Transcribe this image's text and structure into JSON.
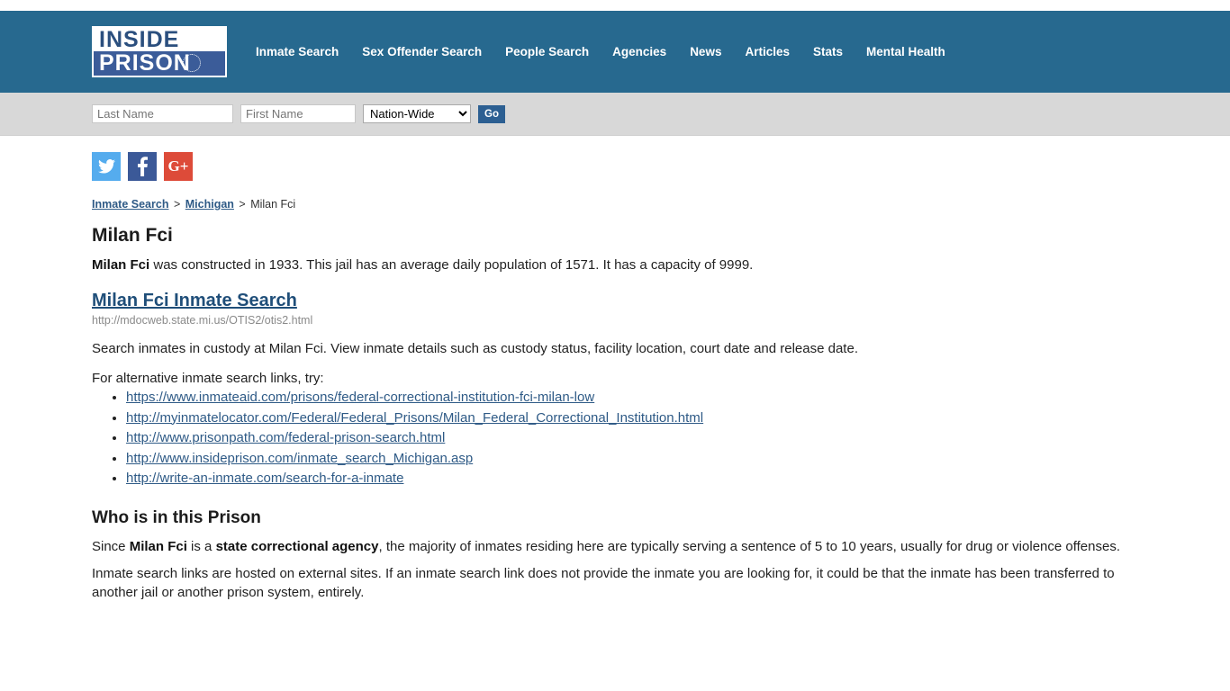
{
  "header": {
    "logo": {
      "line1": "INSIDE",
      "line2": "PRISON",
      "icon": "prison-ring-icon"
    },
    "nav": [
      {
        "label": "Inmate Search"
      },
      {
        "label": "Sex Offender Search"
      },
      {
        "label": "People Search"
      },
      {
        "label": "Agencies"
      },
      {
        "label": "News"
      },
      {
        "label": "Articles"
      },
      {
        "label": "Stats"
      },
      {
        "label": "Mental Health"
      }
    ],
    "brand_color": "#27698f"
  },
  "search_bar": {
    "last_name_placeholder": "Last Name",
    "last_name_value": "",
    "first_name_placeholder": "First Name",
    "first_name_value": "",
    "scope_selected": "Nation-Wide",
    "scope_options": [
      "Nation-Wide"
    ],
    "go_label": "Go",
    "go_color": "#2c5f92"
  },
  "social": [
    {
      "name": "twitter",
      "glyph": "🐦",
      "color": "#55acee"
    },
    {
      "name": "facebook",
      "glyph": "f",
      "color": "#3b5998"
    },
    {
      "name": "google-plus",
      "glyph": "G+",
      "color": "#dd4b39"
    }
  ],
  "breadcrumb": {
    "item1": "Inmate Search",
    "sep1": ">",
    "item2": "Michigan",
    "sep2": ">",
    "current": "Milan Fci"
  },
  "main": {
    "page_title": "Milan Fci",
    "intro_bold": "Milan Fci",
    "intro_rest": " was constructed in 1933. This jail has an average daily population of 1571. It has a capacity of 9999.",
    "search_link_label": "Milan Fci Inmate Search",
    "search_link_url_text": "http://mdocweb.state.mi.us/OTIS2/otis2.html",
    "search_description": "Search inmates in custody at Milan Fci. View inmate details such as custody status, facility location, court date and release date.",
    "alt_intro": "For alternative inmate search links, try:",
    "alt_links": [
      "https://www.inmateaid.com/prisons/federal-correctional-institution-fci-milan-low",
      "http://myinmatelocator.com/Federal/Federal_Prisons/Milan_Federal_Correctional_Institution.html",
      "http://www.prisonpath.com/federal-prison-search.html",
      "http://www.insideprison.com/inmate_search_Michigan.asp",
      "http://write-an-inmate.com/search-for-a-inmate"
    ],
    "who_title": "Who is in this Prison",
    "who_p1_a": "Since ",
    "who_p1_b": "Milan Fci",
    "who_p1_c": " is a ",
    "who_p1_d": "state correctional agency",
    "who_p1_e": ", the majority of inmates residing here are typically serving a sentence of 5 to 10 years, usually for drug or violence offenses.",
    "who_p2": "Inmate search links are hosted on external sites. If an inmate search link does not provide the inmate you are looking for, it could be that the inmate has been transferred to another jail or another prison system, entirely."
  }
}
